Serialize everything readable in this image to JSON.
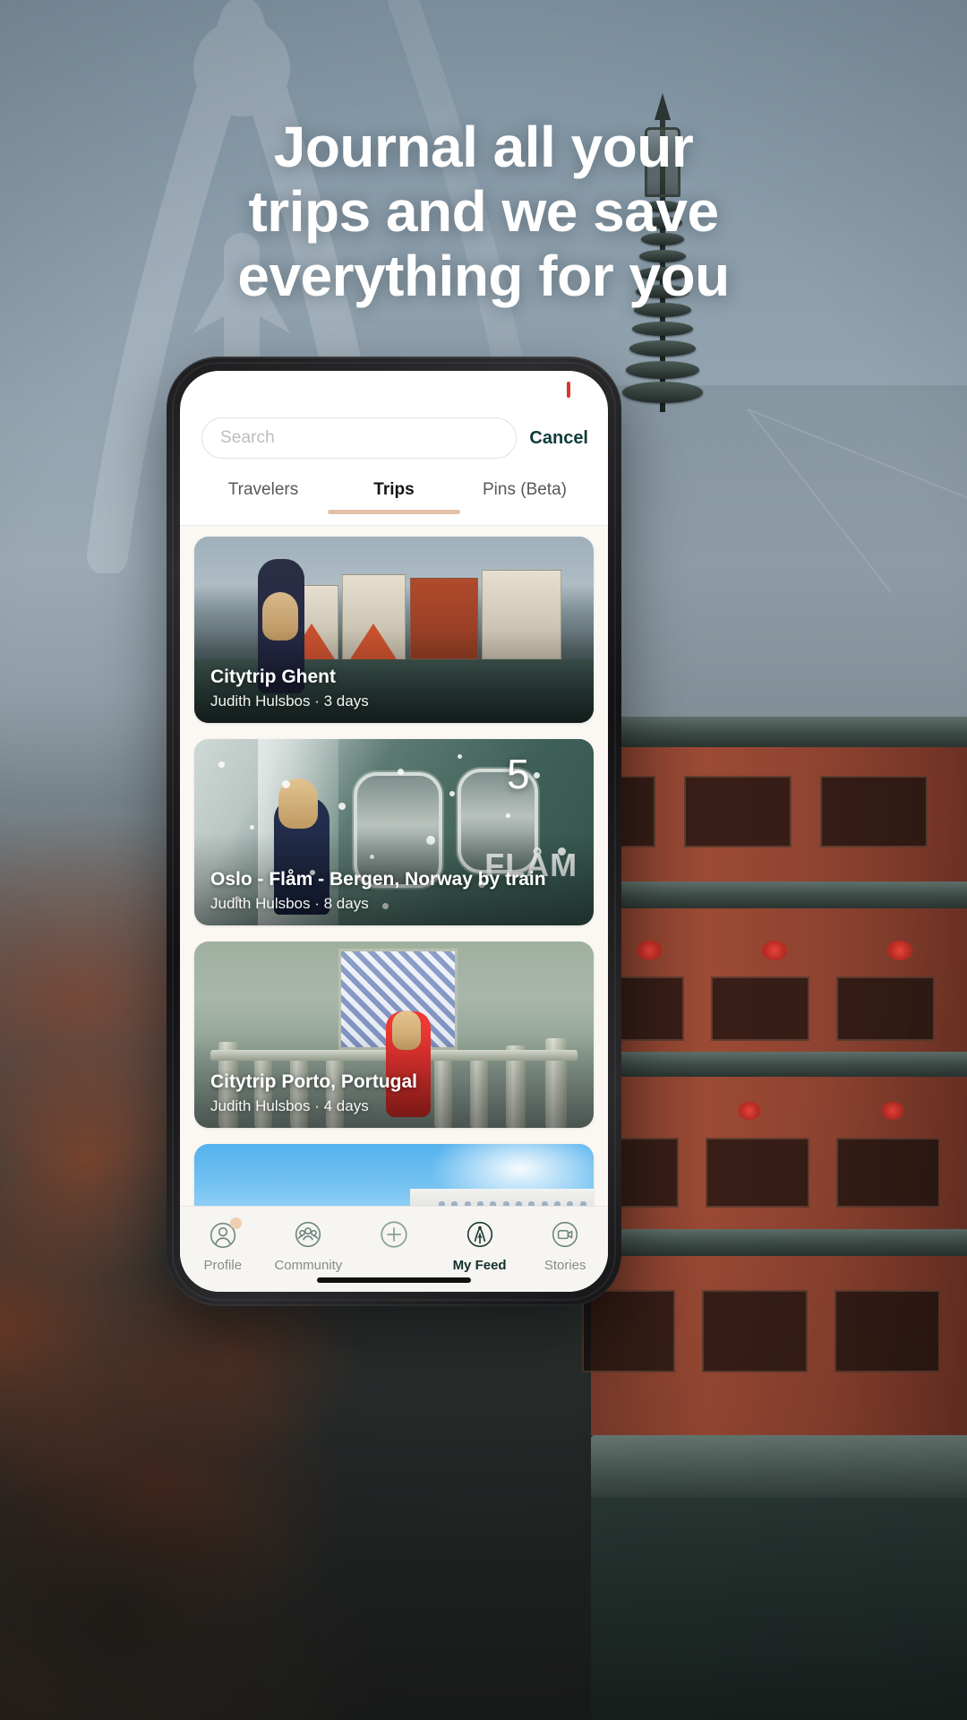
{
  "headline": {
    "line1": "Journal all your",
    "line2": "trips and we save",
    "line3": "everything for you"
  },
  "colors": {
    "accent_underline": "#e3c1a8",
    "cancel_text": "#0f3b3a",
    "nav_active": "#12302c",
    "nav_inactive": "#8b8b86",
    "feed_background": "#fbf8f3",
    "status_indicator": "#d9372b",
    "nav_badge": "#f0cfb0"
  },
  "phone": {
    "search": {
      "placeholder": "Search",
      "value": "",
      "cancel_label": "Cancel"
    },
    "tabs": [
      {
        "label": "Travelers",
        "active": false
      },
      {
        "label": "Trips",
        "active": true
      },
      {
        "label": "Pins (Beta)",
        "active": false
      }
    ],
    "feed": [
      {
        "title": "Citytrip Ghent",
        "author": "Judith Hulsbos",
        "separator": "·",
        "duration": "3 days",
        "subtitle": "Judith Hulsbos · 3 days"
      },
      {
        "title": "Oslo - Flåm - Bergen, Norway by train",
        "author": "Judith Hulsbos",
        "separator": "·",
        "duration": "8 days",
        "subtitle": "Judith Hulsbos · 8 days",
        "photo_text_number": "5",
        "photo_text_brand": "FLÅM"
      },
      {
        "title": "Citytrip Porto, Portugal",
        "author": "Judith Hulsbos",
        "separator": "·",
        "duration": "4 days",
        "subtitle": "Judith Hulsbos · 4 days"
      }
    ],
    "bottom_nav": [
      {
        "label": "Profile",
        "icon": "profile-icon",
        "active": false,
        "badge": true
      },
      {
        "label": "Community",
        "icon": "community-icon",
        "active": false,
        "badge": false
      },
      {
        "label": "",
        "icon": "add-icon",
        "active": false,
        "badge": false
      },
      {
        "label": "My Feed",
        "icon": "compass-icon",
        "active": true,
        "badge": false
      },
      {
        "label": "Stories",
        "icon": "stories-icon",
        "active": false,
        "badge": false
      }
    ]
  }
}
